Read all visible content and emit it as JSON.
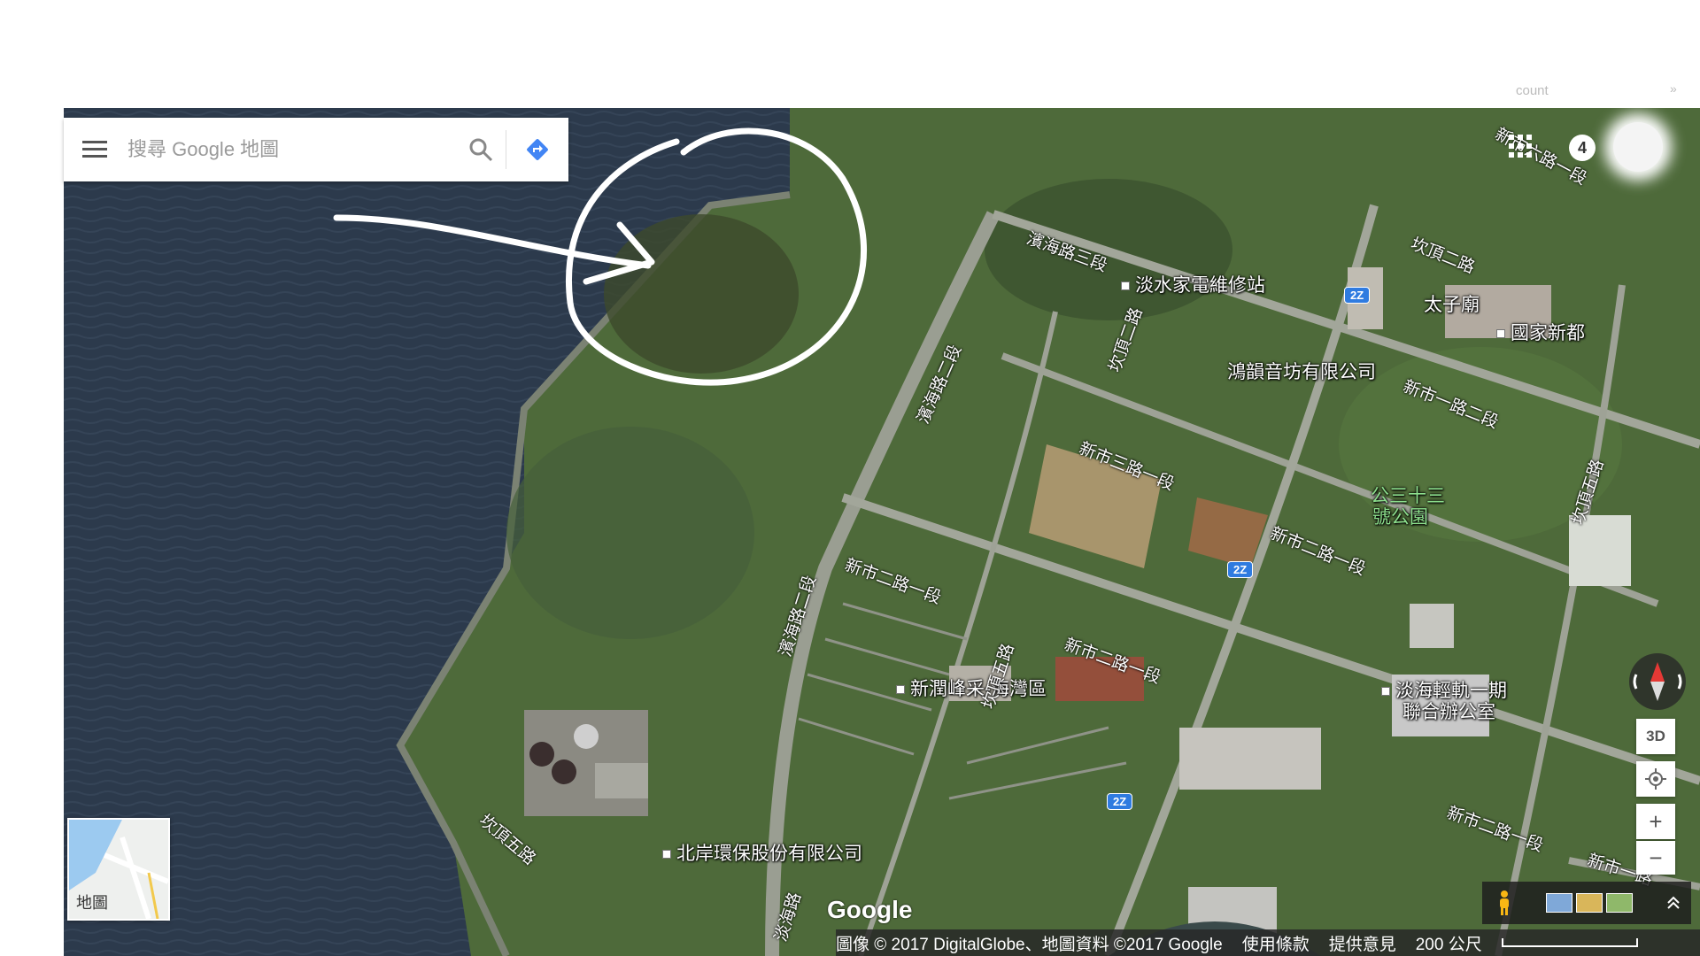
{
  "top": {
    "account_text": "count",
    "chevron": "»",
    "notification_count": "4"
  },
  "search": {
    "placeholder": "搜尋 Google 地圖"
  },
  "icons": {
    "menu": "menu-icon",
    "search": "search-icon",
    "directions": "directions-icon",
    "apps": "apps-grid-icon",
    "compass": "compass-icon",
    "location": "my-location-icon",
    "pegman": "pegman-icon",
    "expand": "chevron-up-icon"
  },
  "map": {
    "places": [
      "淡水家電維修站",
      "太子廟",
      "國家新都",
      "鴻韻音坊有限公司",
      "公三十三",
      "號公園",
      "新潤峰采-海灣區",
      "淡海輕軌一期",
      "聯合辦公室",
      "北岸環保股份有限公司"
    ],
    "roads": [
      "濱海路三段",
      "坎頂二路",
      "坎頂二路",
      "新市六路一段",
      "濱海路二段",
      "新市三路一段",
      "新市二路一段",
      "新市二路一段",
      "新市二路一段",
      "新市一路二段",
      "坎頂五路",
      "坎頂五路",
      "濱海路二段",
      "淡海路",
      "坎頂五路",
      "新市二路一段",
      "新市一路"
    ],
    "route_shields": [
      "2Z",
      "2Z",
      "2Z"
    ]
  },
  "controls": {
    "three_d": "3D",
    "zoom_in": "+",
    "zoom_out": "−"
  },
  "minimap": {
    "label": "地圖"
  },
  "footer": {
    "logo": "Google",
    "imagery": "圖像 © 2017 DigitalGlobe、地圖資料 ©2017 Google",
    "terms": "使用條款",
    "feedback": "提供意見",
    "scale": "200 公尺"
  },
  "colors": {
    "water": "#2c3a4c",
    "land": "#4e6a3a",
    "annotation": "#ffffff",
    "directions": "#4285f4"
  }
}
